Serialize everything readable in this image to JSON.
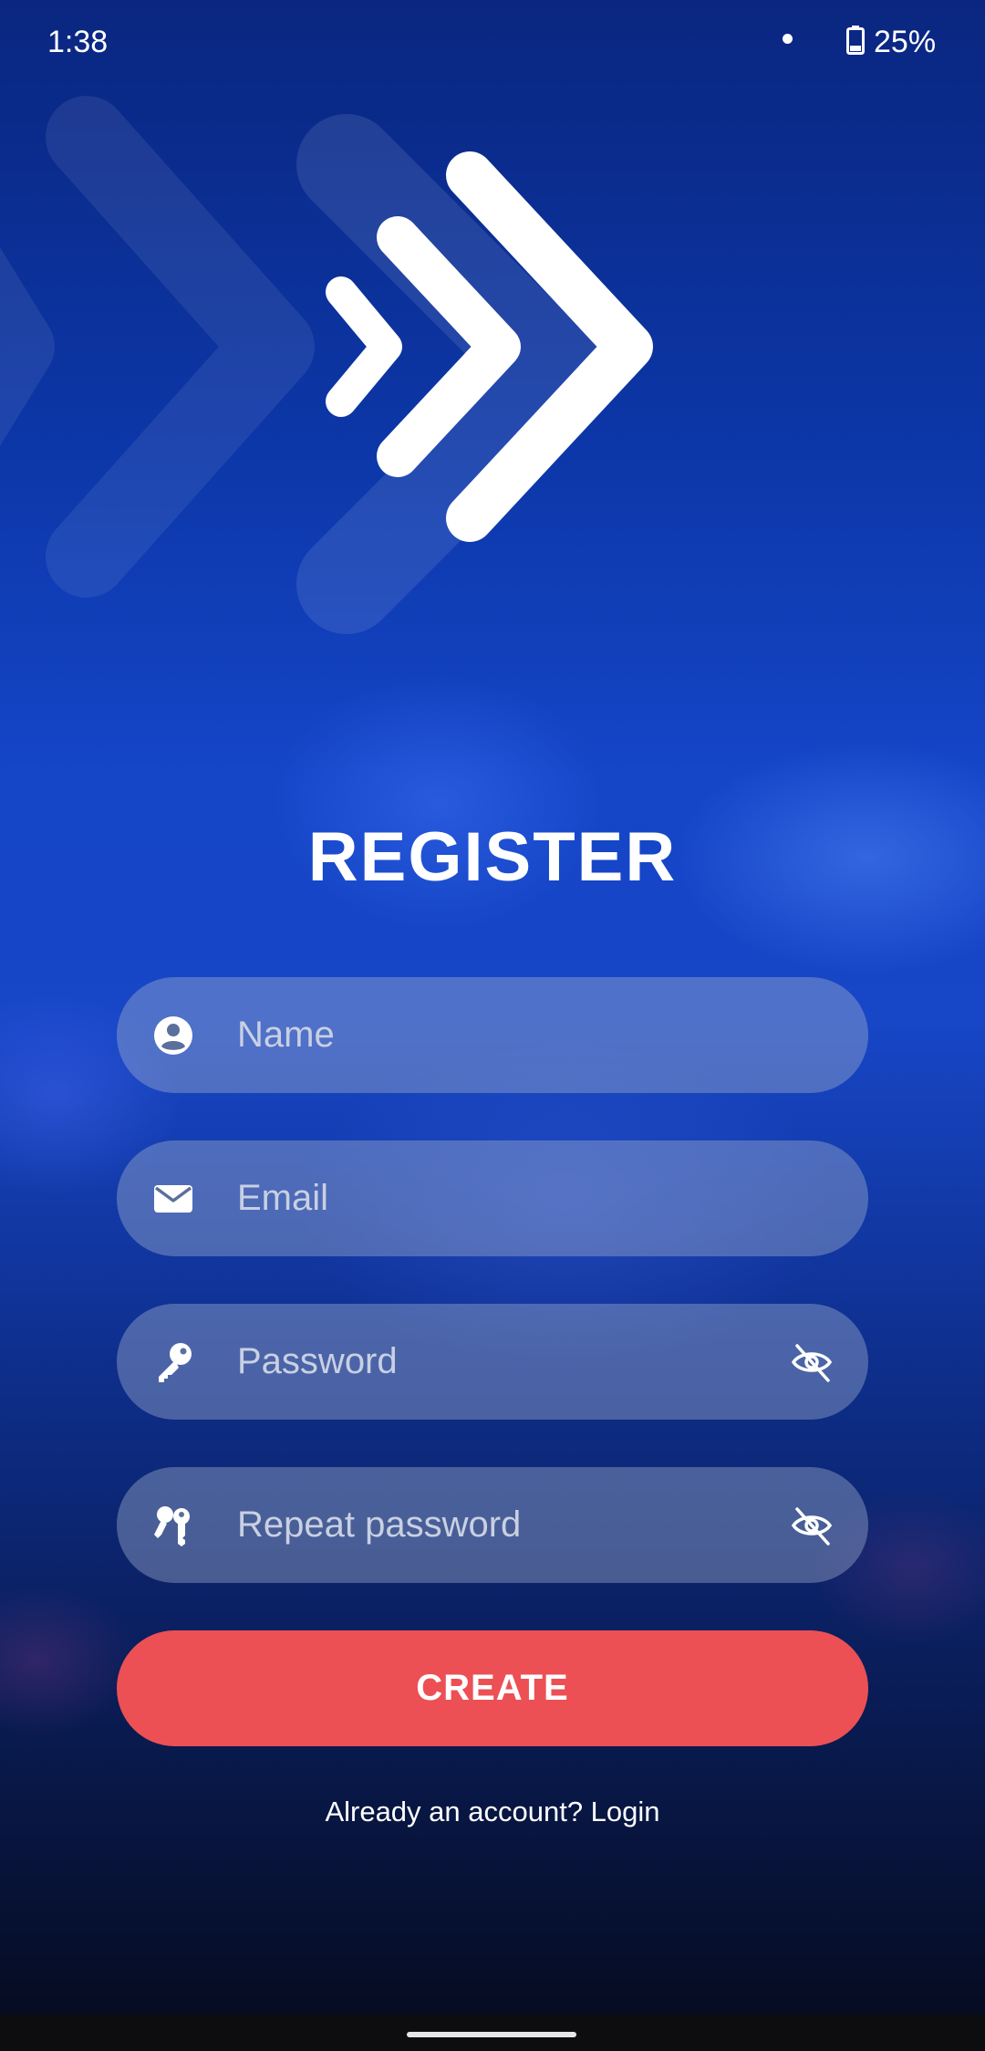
{
  "status_bar": {
    "time": "1:38",
    "battery_percent": "25%",
    "notification_dot_icon": "dot-icon",
    "battery_icon": "battery-icon"
  },
  "logo": {
    "icon": "triple-chevron-right-logo"
  },
  "register": {
    "title": "REGISTER",
    "fields": {
      "name": {
        "placeholder": "Name",
        "icon": "user-circle-icon"
      },
      "email": {
        "placeholder": "Email",
        "icon": "envelope-icon"
      },
      "password": {
        "placeholder": "Password",
        "icon": "key-icon",
        "toggle_icon": "eye-off-icon"
      },
      "repeat_password": {
        "placeholder": "Repeat password",
        "icon": "keys-icon",
        "toggle_icon": "eye-off-icon"
      }
    },
    "create_button": "CREATE",
    "login_link": "Already an account? Login"
  },
  "colors": {
    "accent": "#ec5055",
    "background_top": "#0a2680",
    "background_mid": "#1546c8",
    "field_fill": "#a0afcd"
  }
}
